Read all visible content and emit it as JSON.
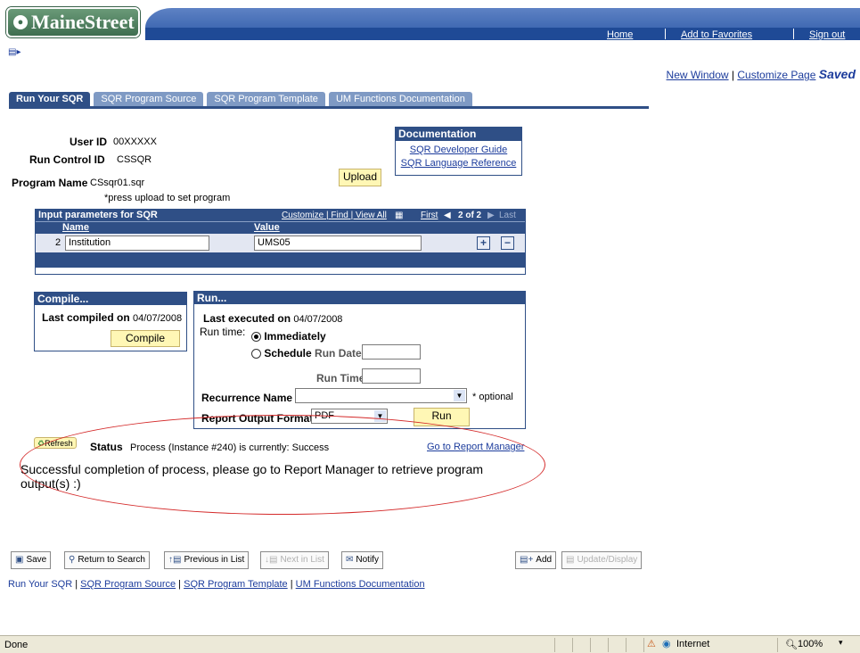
{
  "header": {
    "logo": "MaineStreet",
    "links": [
      "Home",
      "Add to Favorites",
      "Sign out"
    ]
  },
  "toplinks": {
    "new_window": "New Window",
    "customize": "Customize Page",
    "saved": "Saved"
  },
  "tabs": [
    "Run Your SQR",
    "SQR Program Source",
    "SQR Program Template",
    "UM Functions Documentation"
  ],
  "form": {
    "user_id_label": "User ID",
    "user_id": "00XXXXX",
    "run_control_label": "Run Control ID",
    "run_control": "CSSQR",
    "program_name_label": "Program Name",
    "program_name": "CSsqr01.sqr",
    "upload": "Upload",
    "upload_note": "*press upload to set program"
  },
  "documentation": {
    "title": "Documentation",
    "links": [
      "SQR Developer Guide",
      "SQR Language Reference"
    ]
  },
  "grid": {
    "title": "Input parameters for SQR",
    "nav": {
      "customize": "Customize",
      "find": "Find",
      "view_all": "View All",
      "first": "First",
      "count": "2 of 2",
      "last": "Last"
    },
    "col_name": "Name",
    "col_value": "Value",
    "row": {
      "num": "2",
      "name": "Institution",
      "value": "UMS05"
    }
  },
  "compile": {
    "title": "Compile...",
    "last_label": "Last compiled on",
    "last_date": "04/07/2008",
    "button": "Compile"
  },
  "run": {
    "title": "Run...",
    "last_label": "Last executed on",
    "last_date": "04/07/2008",
    "runtime_label": "Run time:",
    "immediately": "Immediately",
    "schedule": "Schedule",
    "run_date": "Run Date",
    "run_time": "Run Time",
    "recurrence_label": "Recurrence Name",
    "optional": "* optional",
    "format_label": "Report Output Format",
    "format_value": "PDF",
    "button": "Run"
  },
  "status": {
    "refresh": "Refresh",
    "label": "Status",
    "text": "Process (Instance #240) is currently: Success",
    "report_link": "Go to Report Manager",
    "message": "Successful completion of process, please go to Report Manager to retrieve program output(s) :)"
  },
  "toolbar": {
    "save": "Save",
    "return": "Return to Search",
    "previous": "Previous in List",
    "next": "Next in List",
    "notify": "Notify",
    "add": "Add",
    "update": "Update/Display"
  },
  "bottom_links": [
    "Run Your SQR",
    "SQR Program Source",
    "SQR Program Template",
    "UM Functions Documentation"
  ],
  "statusbar": {
    "left": "Done",
    "zone": "Internet",
    "zoom": "100%"
  }
}
